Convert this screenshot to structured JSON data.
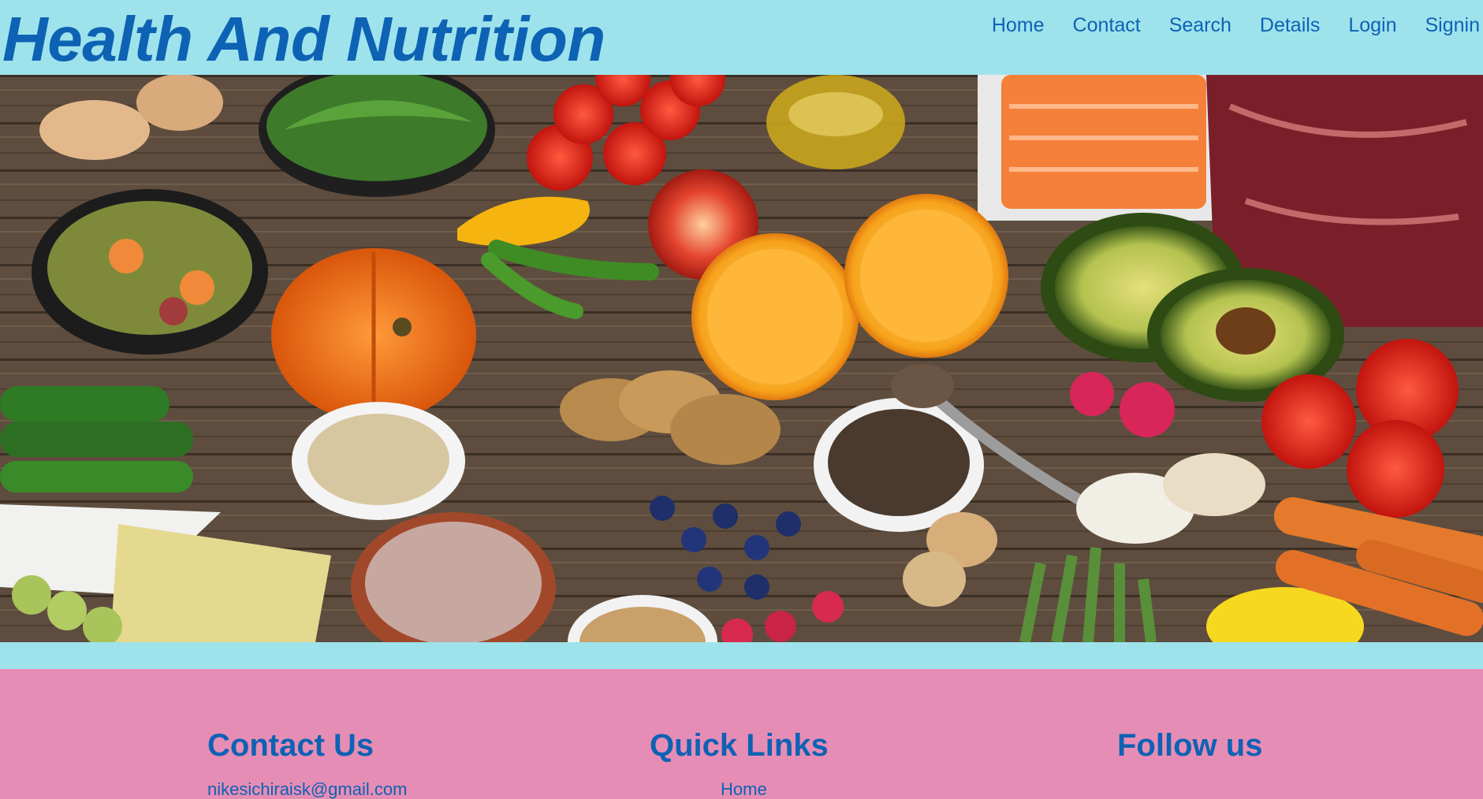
{
  "header": {
    "title": "Health And Nutrition",
    "nav": [
      "Home",
      "Contact",
      "Search",
      "Details",
      "Login",
      "Signin"
    ]
  },
  "hero": {
    "alt": "Assorted healthy foods on a wooden table"
  },
  "footer": {
    "contact": {
      "heading": "Contact Us",
      "email": "nikesichiraisk@gmail.com"
    },
    "links": {
      "heading": "Quick Links",
      "first": "Home"
    },
    "follow": {
      "heading": "Follow us"
    }
  },
  "colors": {
    "header_bg": "#9ee3ec",
    "footer_bg": "#e68db5",
    "accent": "#0e62b4"
  }
}
